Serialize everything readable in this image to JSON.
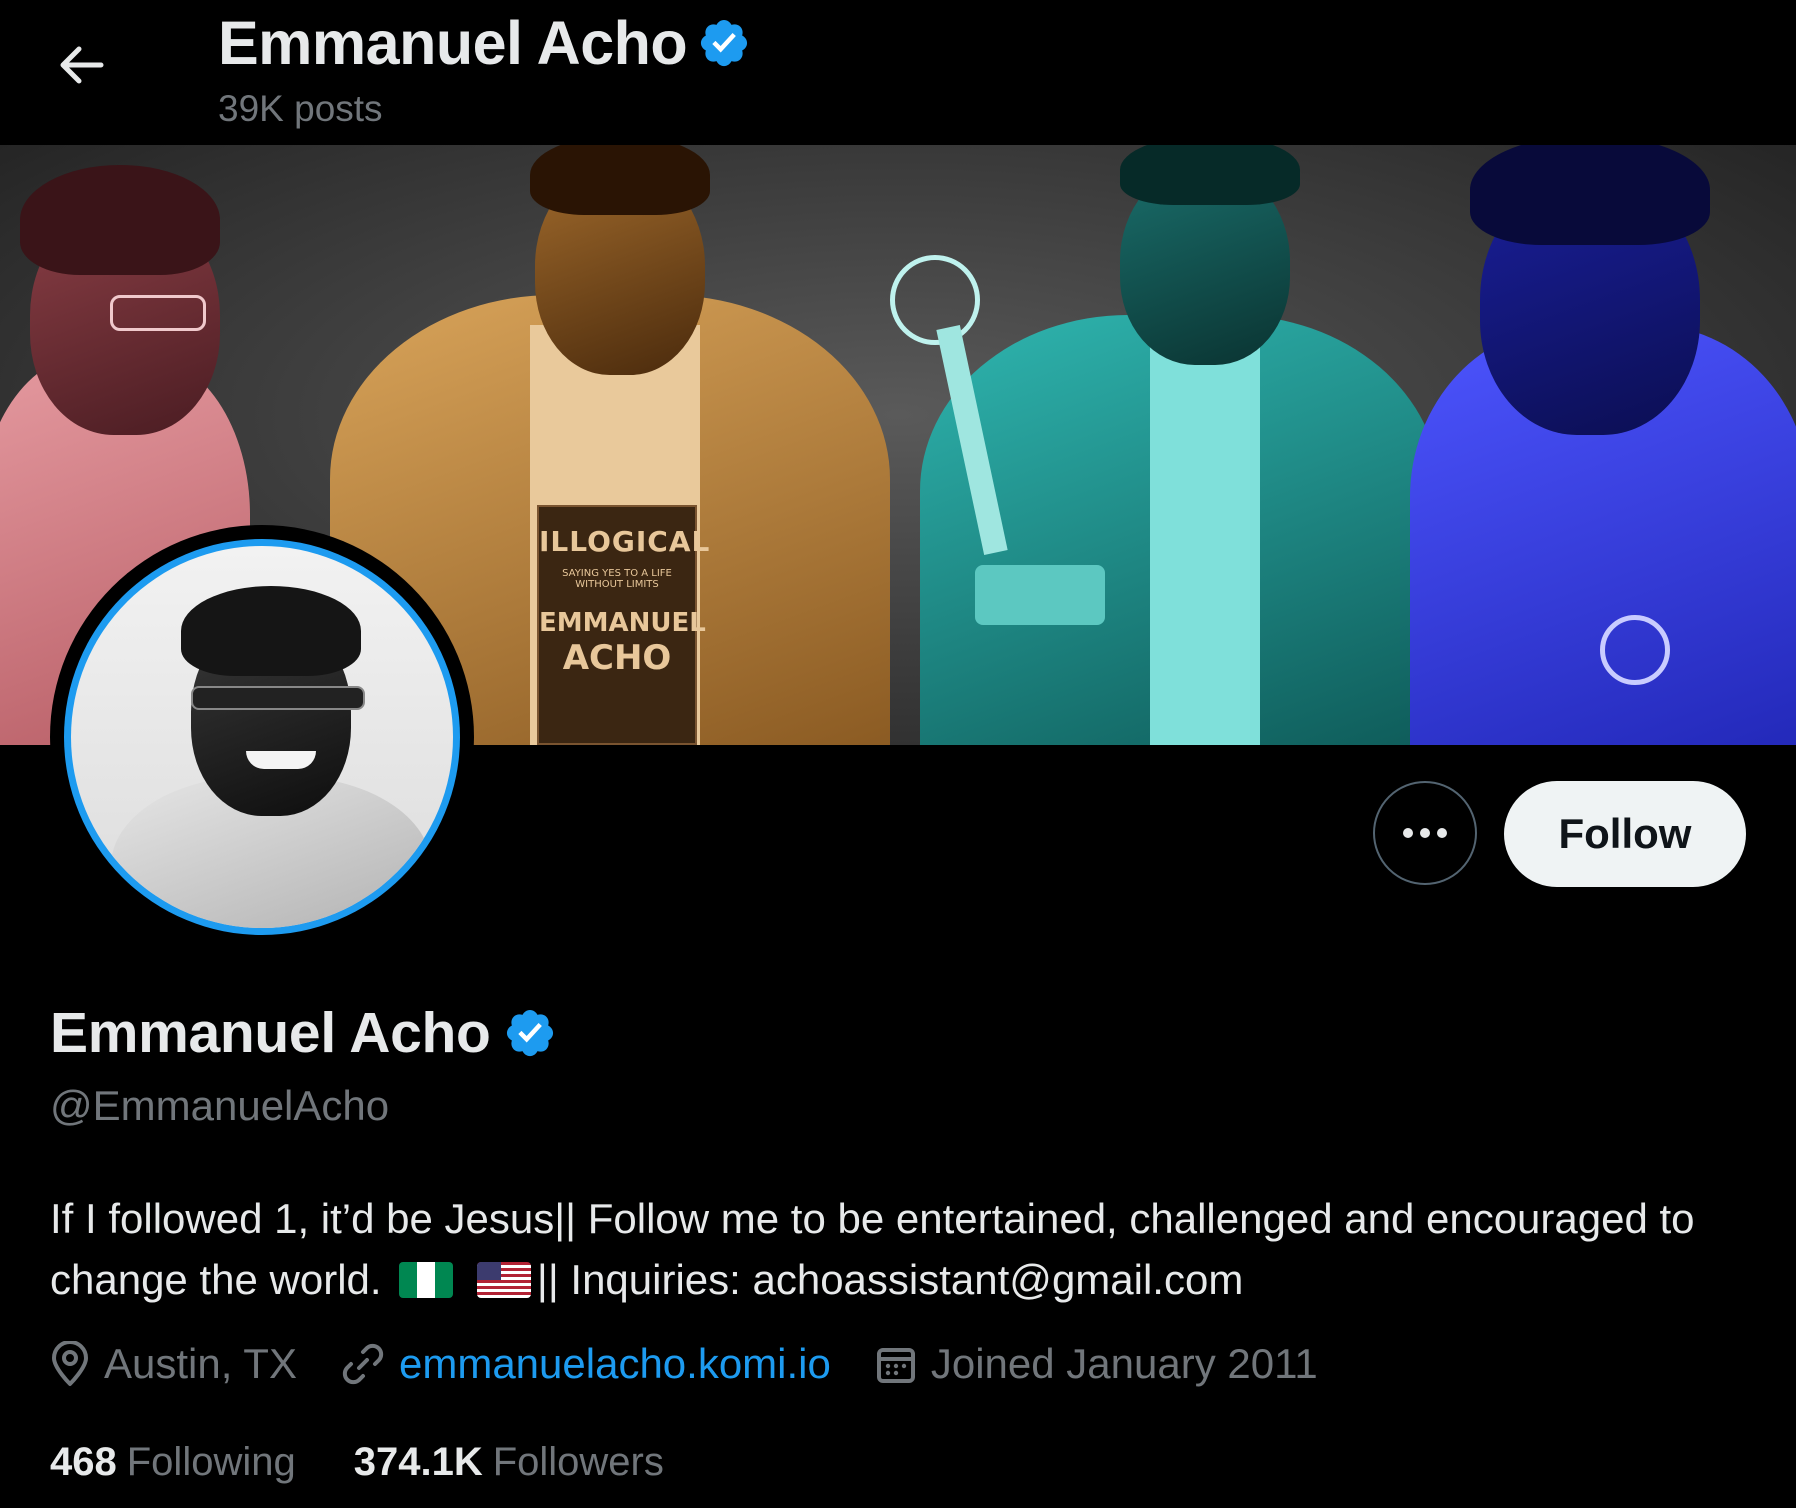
{
  "header": {
    "back_icon": "arrow-left-icon",
    "title": "Emmanuel Acho",
    "posts": "39K posts",
    "verified_icon": "verified-badge-icon"
  },
  "banner": {
    "book": {
      "title": "ILLOGICAL",
      "subtitle": "SAYING YES TO A LIFE WITHOUT LIMITS",
      "author_first": "EMMANUEL",
      "author_last": "ACHO"
    },
    "panel_colors": [
      "#c9737a",
      "#c58a3a",
      "#2aa7a3",
      "#3d43e8"
    ]
  },
  "actions": {
    "more_icon": "more-dots-icon",
    "follow_label": "Follow"
  },
  "profile": {
    "name": "Emmanuel Acho",
    "handle": "@EmmanuelAcho",
    "bio_part1": "If I followed 1, it’d be Jesus|| Follow me to be entertained, challenged and encouraged to change the world.",
    "bio_part2": "|| Inquiries: achoassistant@gmail.com",
    "bio_flags": [
      "nigeria-flag-icon",
      "usa-flag-icon"
    ],
    "location": "Austin, TX",
    "website": "emmanuelacho.komi.io",
    "joined": "Joined January 2011",
    "following_count": "468",
    "following_label": "Following",
    "followers_count": "374.1K",
    "followers_label": "Followers"
  },
  "colors": {
    "accent": "#1d9bf0",
    "background": "#000000",
    "text_primary": "#e7e9ea",
    "text_secondary": "#71767b"
  }
}
